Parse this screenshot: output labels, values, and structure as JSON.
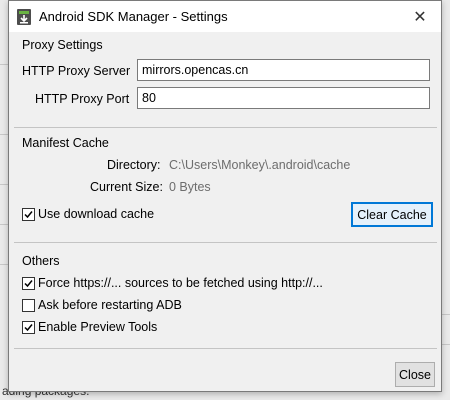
{
  "window": {
    "title": "Android SDK Manager - Settings",
    "close_glyph": "✕"
  },
  "proxy": {
    "section_title": "Proxy Settings",
    "server_label": "HTTP Proxy Server",
    "server_value": "mirrors.opencas.cn",
    "port_label": "HTTP Proxy Port",
    "port_value": "80"
  },
  "manifest": {
    "section_title": "Manifest Cache",
    "directory_label": "Directory:",
    "directory_value": "C:\\Users\\Monkey\\.android\\cache",
    "size_label": "Current Size:",
    "size_value": "0 Bytes",
    "use_cache_label": "Use download cache",
    "use_cache_checked": true,
    "clear_button": "Clear Cache"
  },
  "others": {
    "section_title": "Others",
    "options": [
      {
        "label": "Force https://... sources to be fetched using http://...",
        "checked": true
      },
      {
        "label": "Ask before restarting ADB",
        "checked": false
      },
      {
        "label": "Enable Preview Tools",
        "checked": true
      }
    ]
  },
  "footer": {
    "close_button": "Close"
  },
  "background": {
    "status_text": "ading packages."
  },
  "colors": {
    "accent": "#0078d7",
    "window_bg": "#f0f0f0",
    "icon_green": "#6ab343"
  },
  "icons": {
    "app": "android-sdk-download-icon",
    "close": "close-icon",
    "check": "checkmark-icon"
  }
}
